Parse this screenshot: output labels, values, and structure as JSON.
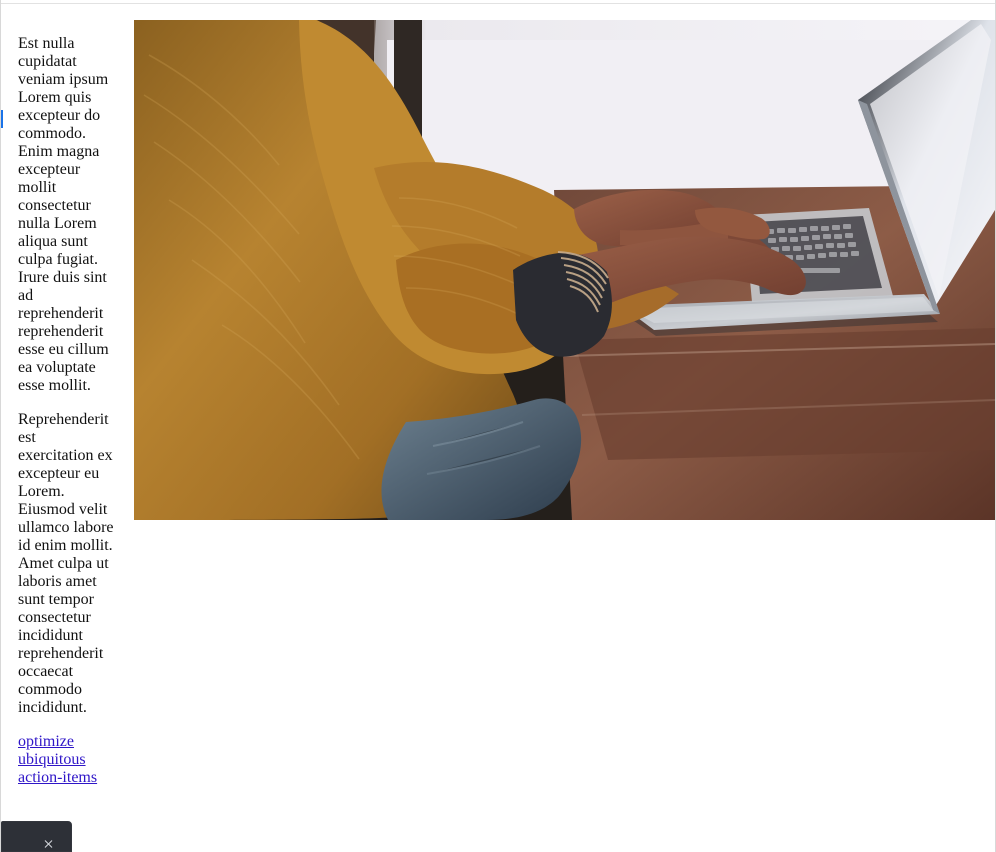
{
  "content": {
    "paragraphs": [
      "Est nulla cupidatat veniam ipsum Lorem quis excepteur do commodo. Enim magna excepteur mollit consectetur nulla Lorem aliqua sunt culpa fugiat. Irure duis sint ad reprehenderit reprehenderit esse eu cillum ea voluptate esse mollit.",
      "Reprehenderit est exercitation ex excepteur eu Lorem. Eiusmod velit ullamco labore id enim mollit. Amet culpa ut laboris amet sunt tempor consectetur incididunt reprehenderit occaecat commodo incididunt."
    ],
    "link_text": "optimize ubiquitous action-items"
  },
  "icons": {
    "close": "close-icon"
  },
  "colors": {
    "link": "#2f16c8",
    "accent": "#1a73e8",
    "widget_background": "#2d3037"
  }
}
